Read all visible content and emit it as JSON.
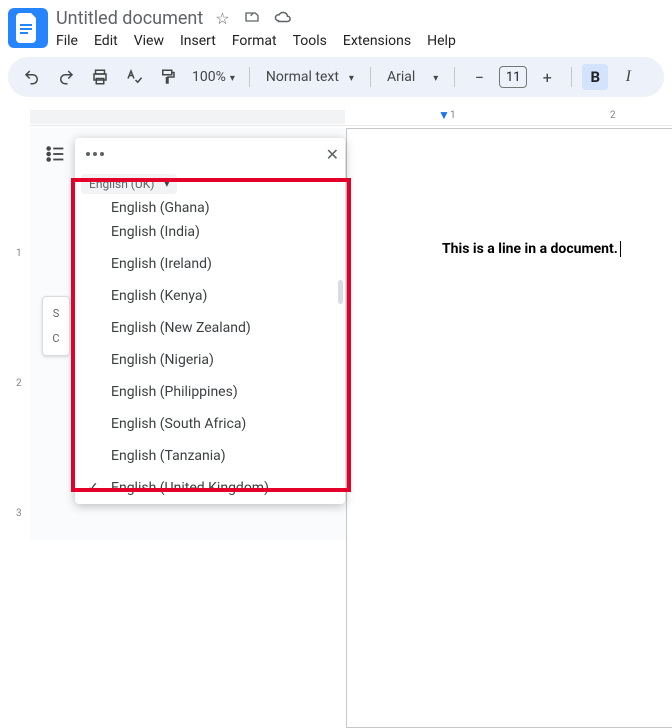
{
  "title": "Untitled document",
  "menubar": [
    "File",
    "Edit",
    "View",
    "Insert",
    "Format",
    "Tools",
    "Extensions",
    "Help"
  ],
  "toolbar": {
    "zoom": "100%",
    "paragraph_style": "Normal text",
    "font": "Arial",
    "font_size": "11"
  },
  "ruler_h": [
    "1",
    "2"
  ],
  "ruler_v": [
    "1",
    "2",
    "3"
  ],
  "document_body": "This is a line in a document.",
  "side_card": {
    "top": "S",
    "bottom": "C"
  },
  "language_panel": {
    "current_chip": "English (UK)",
    "items": [
      {
        "label": "English (Ghana)",
        "selected": false,
        "cut": true
      },
      {
        "label": "English (India)",
        "selected": false
      },
      {
        "label": "English (Ireland)",
        "selected": false
      },
      {
        "label": "English (Kenya)",
        "selected": false
      },
      {
        "label": "English (New Zealand)",
        "selected": false
      },
      {
        "label": "English (Nigeria)",
        "selected": false
      },
      {
        "label": "English (Philippines)",
        "selected": false
      },
      {
        "label": "English (South Africa)",
        "selected": false
      },
      {
        "label": "English (Tanzania)",
        "selected": false
      },
      {
        "label": "English (United Kingdom)",
        "selected": true
      }
    ]
  }
}
